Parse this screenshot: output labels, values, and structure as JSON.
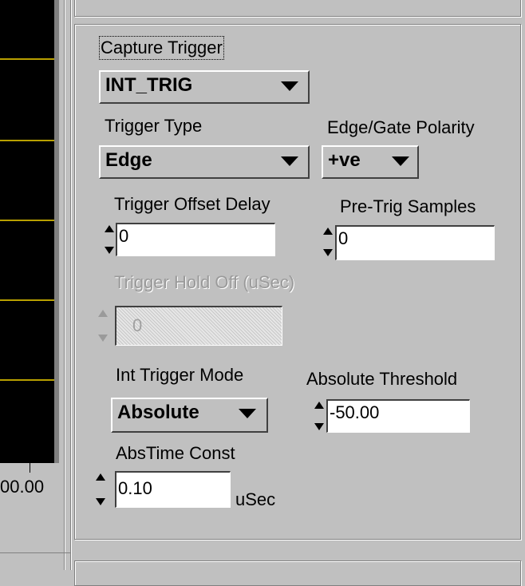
{
  "graph": {
    "x_axis_label": "00.00"
  },
  "trigger_panel": {
    "capture_trigger": {
      "label": "Capture Trigger",
      "value": "INT_TRIG"
    },
    "trigger_type": {
      "label": "Trigger Type",
      "value": "Edge"
    },
    "edge_gate_polarity": {
      "label": "Edge/Gate Polarity",
      "value": "+ve"
    },
    "trigger_offset_delay": {
      "label": "Trigger Offset Delay",
      "value": "0"
    },
    "pre_trig_samples": {
      "label": "Pre-Trig Samples",
      "value": "0"
    },
    "trigger_hold_off": {
      "label": "Trigger Hold Off (uSec)",
      "value": "0",
      "enabled": false
    },
    "int_trigger_mode": {
      "label": "Int Trigger Mode",
      "value": "Absolute"
    },
    "absolute_threshold": {
      "label": "Absolute Threshold",
      "value": "-50.00"
    },
    "abs_time_const": {
      "label": "AbsTime Const",
      "value": "0.10",
      "unit": "uSec"
    }
  },
  "icons": {
    "spin": "up-down-arrows",
    "dropdown": "triangle-down"
  }
}
